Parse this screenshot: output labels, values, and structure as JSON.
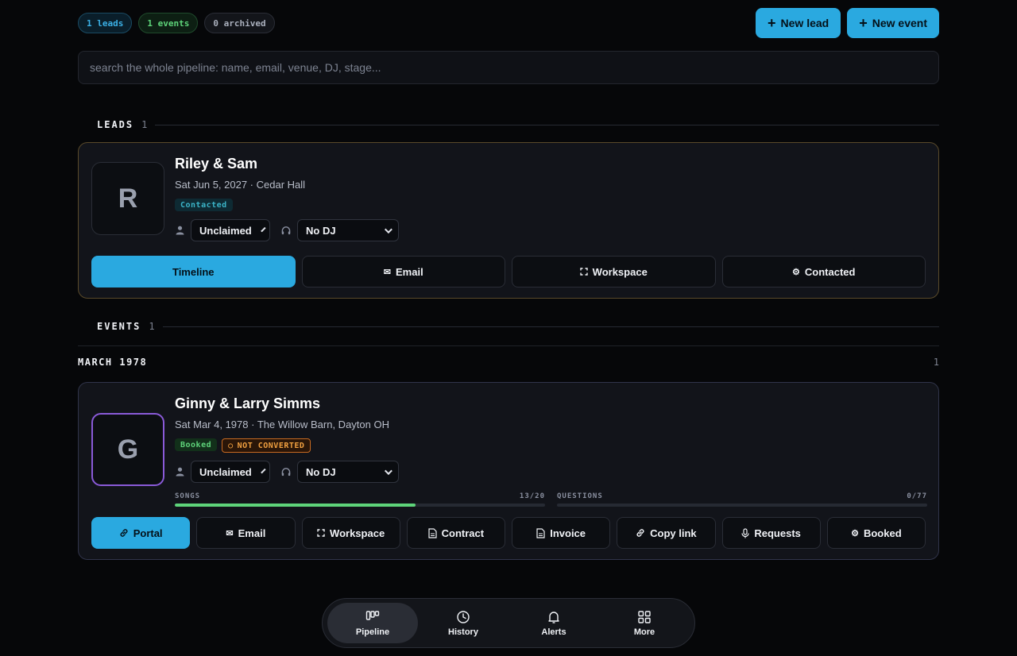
{
  "summary": {
    "leads": "1 leads",
    "events": "1 events",
    "archived": "0 archived"
  },
  "top_actions": {
    "new_lead": "New lead",
    "new_event": "New event"
  },
  "search": {
    "placeholder": "search the whole pipeline: name, email, venue, DJ, stage..."
  },
  "leads_section": {
    "title": "LEADS",
    "count": "1"
  },
  "lead_card": {
    "initial": "R",
    "name": "Riley & Sam",
    "subtitle": "Sat Jun 5, 2027 · Cedar Hall",
    "stage_badge": "Contacted",
    "owner": "Unclaimed",
    "dj": "No DJ",
    "actions": {
      "timeline": "Timeline",
      "email": "Email",
      "workspace": "Workspace",
      "stage": "Contacted"
    }
  },
  "events_section": {
    "title": "EVENTS",
    "count": "1"
  },
  "month_group": {
    "label": "MARCH 1978",
    "count": "1"
  },
  "event_card": {
    "initial": "G",
    "name": "Ginny & Larry Simms",
    "subtitle": "Sat Mar 4, 1978 · The Willow Barn, Dayton OH",
    "stage_badge": "Booked",
    "warning_badge": "NOT CONVERTED",
    "owner": "Unclaimed",
    "dj": "No DJ",
    "songs": {
      "label": "SONGS",
      "value": "13/20",
      "fraction": 0.65
    },
    "questions": {
      "label": "QUESTIONS",
      "value": "0/77",
      "fraction": 0
    },
    "actions": {
      "portal": "Portal",
      "email": "Email",
      "workspace": "Workspace",
      "contract": "Contract",
      "invoice": "Invoice",
      "copy_link": "Copy link",
      "requests": "Requests",
      "stage": "Booked"
    }
  },
  "nav": {
    "pipeline": "Pipeline",
    "history": "History",
    "alerts": "Alerts",
    "more": "More"
  },
  "colors": {
    "accent": "#2aa9e0",
    "success": "#5ed47a",
    "warning": "#f0a040",
    "avatar_highlight": "#8a5ad8"
  }
}
